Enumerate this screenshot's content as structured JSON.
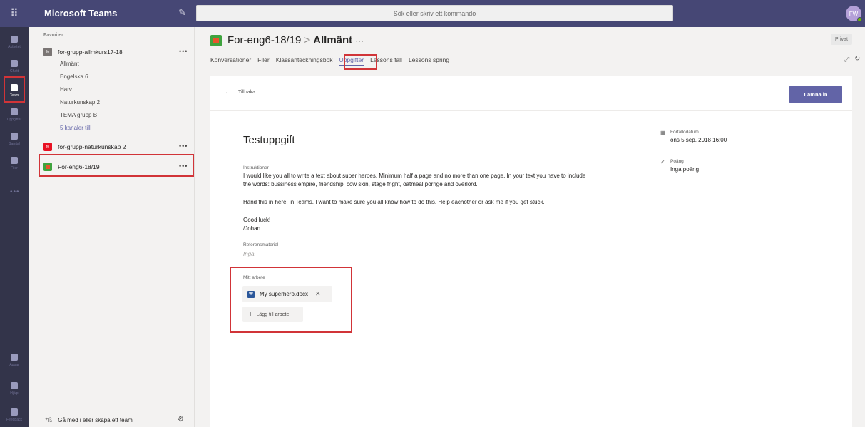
{
  "header": {
    "app_title": "Microsoft Teams",
    "search_placeholder": "Sök eller skriv ett kommando",
    "avatar_initials": "FW"
  },
  "rail": {
    "items": [
      {
        "label": "Aktivitet",
        "icon": "bell-icon"
      },
      {
        "label": "Chatt",
        "icon": "chat-icon"
      },
      {
        "label": "Team",
        "icon": "teams-icon",
        "active": true
      },
      {
        "label": "Uppgifter",
        "icon": "assignments-icon"
      },
      {
        "label": "Samtal",
        "icon": "phone-icon"
      },
      {
        "label": "Filer",
        "icon": "files-icon"
      }
    ],
    "more": "•••",
    "bottom": [
      {
        "label": "Appar",
        "icon": "apps-icon"
      },
      {
        "label": "Hjälp",
        "icon": "help-icon"
      },
      {
        "label": "Feedback",
        "icon": "feedback-icon"
      }
    ]
  },
  "teams_pane": {
    "favorites_label": "Favoriter",
    "teams": [
      {
        "name": "for-grupp-allmkurs17-18",
        "badge": "fo",
        "badge_color": "#7a7574",
        "channels": [
          "Allmänt",
          "Engelska 6",
          "Harv",
          "Naturkunskap 2",
          "TEMA grupp B"
        ],
        "more_channels": "5 kanaler till"
      },
      {
        "name": "for-grupp-naturkunskap 2",
        "badge": "fo",
        "badge_color": "#e81123"
      },
      {
        "name": "For-eng6-18/19",
        "badge": "",
        "badge_color": "#3fa33e"
      }
    ],
    "more_dots": "•••",
    "join_label": "Gå med i eller skapa ett team"
  },
  "channel_header": {
    "team": "For-eng6-18/19",
    "separator": ">",
    "channel": "Allmänt",
    "more": "···",
    "privacy": "Privat",
    "tabs": [
      "Konversationer",
      "Filer",
      "Klassanteckningsbok",
      "Uppgifter",
      "Lessons fall",
      "Lessons spring"
    ],
    "active_tab": "Uppgifter"
  },
  "assignment": {
    "back_label": "Tillbaka",
    "turn_in_label": "Lämna in",
    "title": "Testuppgift",
    "instructions_label": "Instruktioner",
    "instructions_p1": "I would like you all to write a text about super heroes. Minimum half a page and no more than one page. In your text you have to include",
    "instructions_p1b": "the words: bussiness empire, friendship, cow skin, stage fright, oatmeal porrige and overlord.",
    "instructions_p2": "Hand this in here, in Teams. I want to make sure you all know how to do this. Help eachother or ask me if you get stuck.",
    "instructions_p3": "Good luck!",
    "instructions_p4": "/Johan",
    "reference_label": "Referensmaterial",
    "reference_value": "Inga",
    "my_work_label": "Mitt arbete",
    "file_name": "My superhero.docx",
    "add_work_label": "Lägg till arbete",
    "due_label": "Förfallodatum",
    "due_value": "ons 5 sep. 2018 16:00",
    "points_label": "Poäng",
    "points_value": "Inga poäng"
  }
}
